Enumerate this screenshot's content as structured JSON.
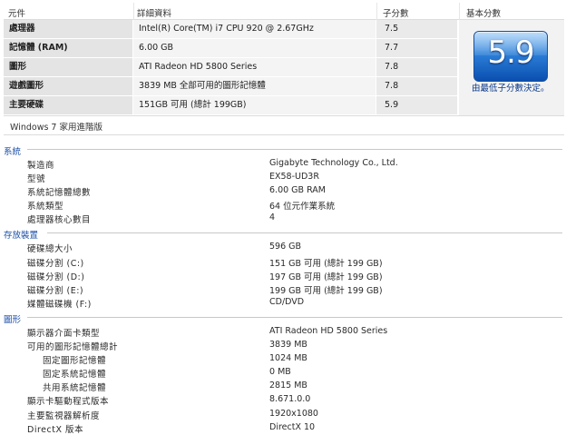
{
  "score_table": {
    "headers": {
      "component": "元件",
      "details": "詳細資料",
      "subscore": "子分數",
      "base_score": "基本分數"
    },
    "rows": [
      {
        "component": "處理器",
        "details": "Intel(R) Core(TM) i7 CPU 920 @ 2.67GHz",
        "subscore": "7.5"
      },
      {
        "component": "記憶體 (RAM)",
        "details": "6.00 GB",
        "subscore": "7.7"
      },
      {
        "component": "圖形",
        "details": "ATI Radeon HD 5800 Series",
        "subscore": "7.8"
      },
      {
        "component": "遊戲圖形",
        "details": "3839 MB 全部可用的圖形記憶體",
        "subscore": "7.8"
      },
      {
        "component": "主要硬碟",
        "details": "151GB 可用 (總計 199GB)",
        "subscore": "5.9"
      }
    ],
    "base_score": "5.9",
    "base_note": "由最低子分數決定。",
    "edition": "Windows 7 家用進階版"
  },
  "sections": [
    {
      "title": "系統",
      "items": [
        {
          "label": "製造商",
          "value": "Gigabyte Technology Co., Ltd.",
          "indent": false
        },
        {
          "label": "型號",
          "value": "EX58-UD3R",
          "indent": false
        },
        {
          "label": "系統記憶體總數",
          "value": "6.00 GB RAM",
          "indent": false
        },
        {
          "label": "系統類型",
          "value": "64 位元作業系統",
          "indent": false
        },
        {
          "label": "處理器核心數目",
          "value": "4",
          "indent": false
        }
      ]
    },
    {
      "title": "存放裝置",
      "items": [
        {
          "label": "硬碟總大小",
          "value": "596 GB",
          "indent": false
        },
        {
          "label": "磁碟分割 (C:)",
          "value": "151 GB 可用 (總計 199 GB)",
          "indent": false
        },
        {
          "label": "磁碟分割 (D:)",
          "value": "197 GB 可用 (總計 199 GB)",
          "indent": false
        },
        {
          "label": "磁碟分割 (E:)",
          "value": "199 GB 可用 (總計 199 GB)",
          "indent": false
        },
        {
          "label": "媒體磁碟機 (F:)",
          "value": "CD/DVD",
          "indent": false
        }
      ]
    },
    {
      "title": "圖形",
      "items": [
        {
          "label": "顯示器介面卡類型",
          "value": "ATI Radeon HD 5800 Series",
          "indent": false
        },
        {
          "label": "可用的圖形記憶體總計",
          "value": "3839 MB",
          "indent": false
        },
        {
          "label": "固定圖形記憶體",
          "value": "1024 MB",
          "indent": true
        },
        {
          "label": "固定系統記憶體",
          "value": "0 MB",
          "indent": true
        },
        {
          "label": "共用系統記憶體",
          "value": "2815 MB",
          "indent": true
        },
        {
          "label": "顯示卡驅動程式版本",
          "value": "8.671.0.0",
          "indent": false
        },
        {
          "label": "主要監視器解析度",
          "value": "1920x1080",
          "indent": false
        },
        {
          "label": "DirectX 版本",
          "value": "DirectX 10",
          "indent": false
        }
      ]
    }
  ]
}
